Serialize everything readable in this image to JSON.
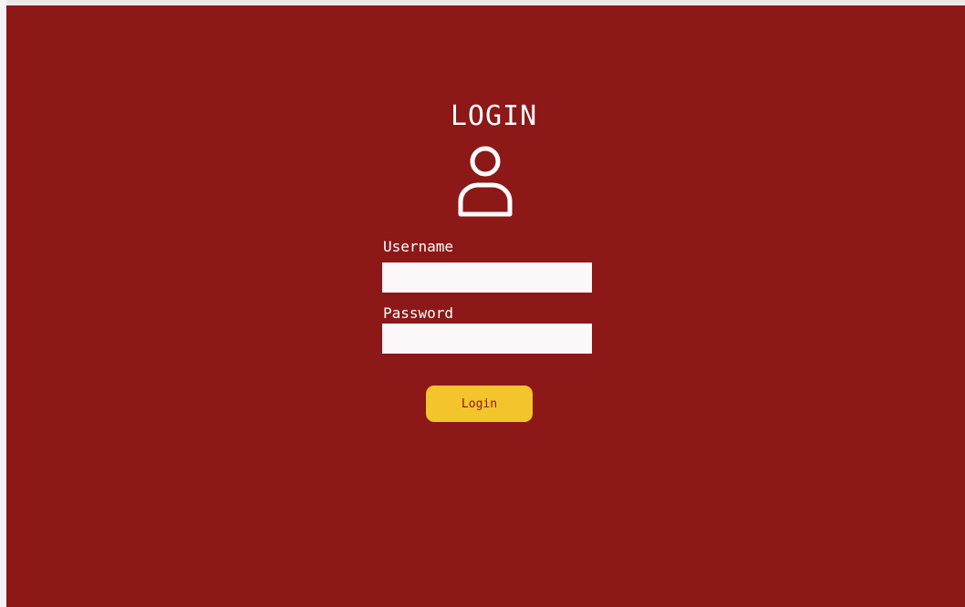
{
  "header": {
    "title": "LOGIN"
  },
  "form": {
    "username_label": "Username",
    "username_value": "",
    "password_label": "Password",
    "password_value": "",
    "submit_label": "Login"
  },
  "icons": {
    "user": "user-icon"
  },
  "colors": {
    "background": "#8c1818",
    "button": "#f3c42c",
    "button_text": "#8c1818",
    "input_background": "#fcf8fa",
    "text": "#ffffff"
  }
}
